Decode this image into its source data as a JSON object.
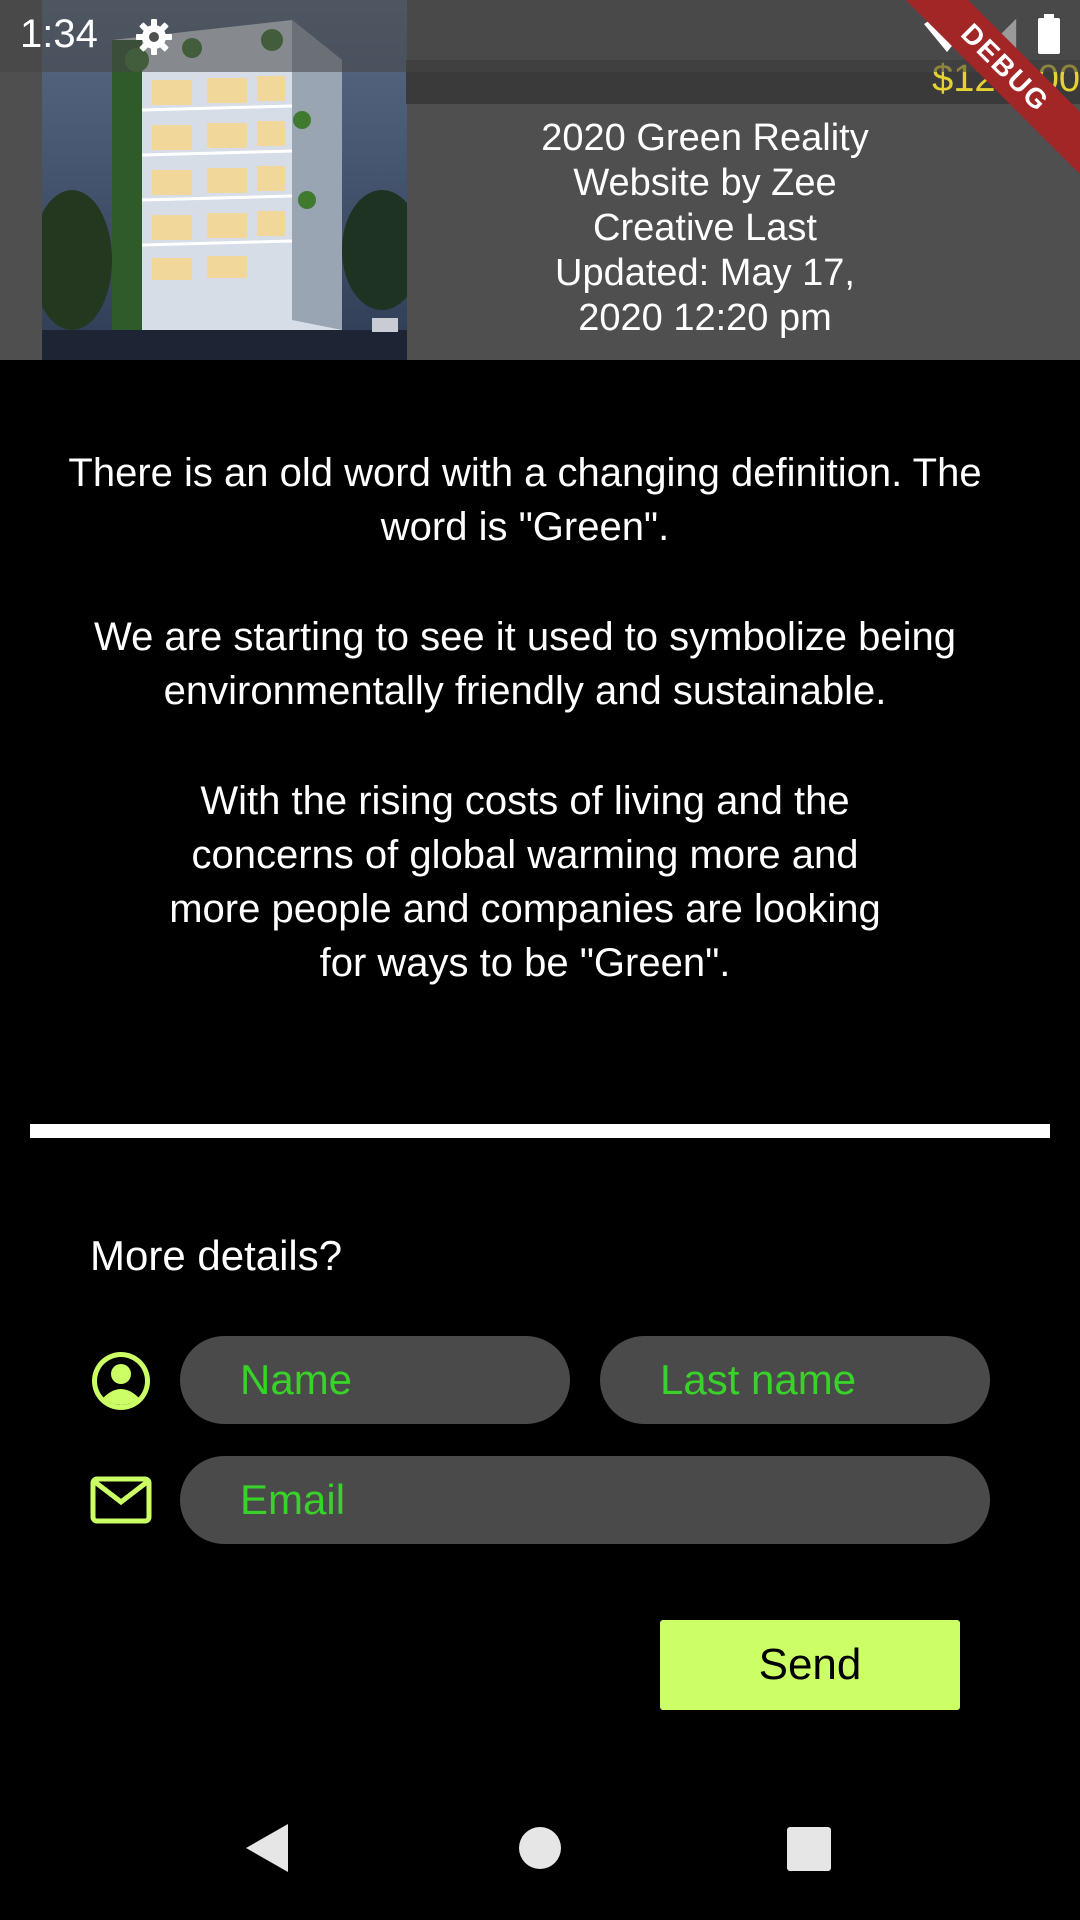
{
  "status_bar": {
    "time": "1:34",
    "icons": [
      "gear-icon",
      "wifi-icon",
      "signal-icon",
      "battery-icon"
    ]
  },
  "debug_banner": {
    "label": "DEBUG"
  },
  "header": {
    "price": "$120000",
    "text": "2020 Green Reality Website by Zee Creative Last Updated: May 17, 2020 12:20 pm",
    "line1": "2020 Green Reality",
    "line2": "Website by Zee",
    "line3": "Creative Last",
    "line4": "Updated: May 17,",
    "line5": "2020 12:20 pm"
  },
  "intro": {
    "p1": "There is an old word with a changing definition. The word is \"Green\".",
    "p2": "We are starting to see it used to symbolize being environmentally friendly and sustainable.",
    "p3": "With the rising costs of living and the concerns of global warming more and more people and companies are looking for ways to be \"Green\"."
  },
  "form": {
    "heading": "More details?",
    "name_placeholder": "Name",
    "last_name_placeholder": "Last name",
    "email_placeholder": "Email",
    "send_label": "Send"
  },
  "colors": {
    "accent": "#ccff66",
    "placeholder_green": "#39d22a",
    "price_yellow": "#e7d233",
    "header_bg": "#4f4f4f",
    "field_bg": "#4a4a4a"
  },
  "nav_bar": {
    "icons": [
      "back-icon",
      "home-icon",
      "recent-apps-icon"
    ]
  }
}
